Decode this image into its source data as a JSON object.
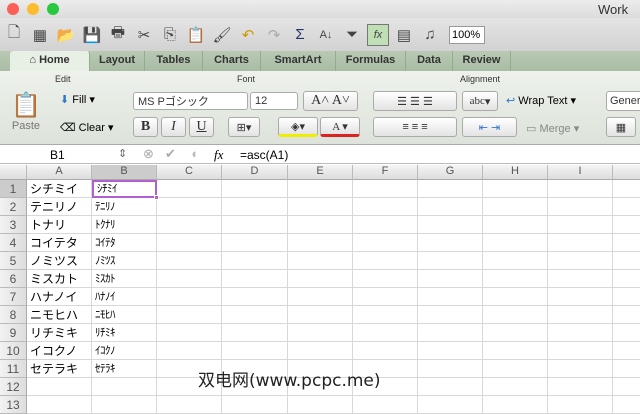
{
  "window": {
    "title": "Work"
  },
  "toolbar": {
    "zoom": "100%"
  },
  "tabs": [
    "Home",
    "Layout",
    "Tables",
    "Charts",
    "SmartArt",
    "Formulas",
    "Data",
    "Review"
  ],
  "ribbon": {
    "groups": {
      "edit": "Edit",
      "font": "Font",
      "alignment": "Alignment"
    },
    "fill": "Fill",
    "clear": "Clear",
    "paste": "Paste",
    "font_name": "MS Pゴシック",
    "font_size": "12",
    "bold": "B",
    "italic": "I",
    "underline": "U",
    "abc": "abc",
    "wrap_text": "Wrap Text",
    "merge": "Merge",
    "number_format": "Gener"
  },
  "formula_bar": {
    "name_box": "B1",
    "fx": "fx",
    "formula": "=asc(A1)"
  },
  "columns": [
    "A",
    "B",
    "C",
    "D",
    "E",
    "F",
    "G",
    "H",
    "I"
  ],
  "rows": [
    {
      "n": "1",
      "a": "シチミイ",
      "b": "ｼﾁﾐｲ"
    },
    {
      "n": "2",
      "a": "テニリノ",
      "b": "ﾃﾆﾘﾉ"
    },
    {
      "n": "3",
      "a": "トナリ",
      "b": "ﾄｸﾅﾘ"
    },
    {
      "n": "4",
      "a": "コイテタ",
      "b": "ｺｲﾃﾀ"
    },
    {
      "n": "5",
      "a": "ノミツス",
      "b": "ﾉﾐﾂｽ"
    },
    {
      "n": "6",
      "a": "ミスカト",
      "b": "ﾐｽｶﾄ"
    },
    {
      "n": "7",
      "a": "ハナノイ",
      "b": "ﾊﾅﾉｲ"
    },
    {
      "n": "8",
      "a": "ニモヒハ",
      "b": "ﾆﾓﾋﾊ"
    },
    {
      "n": "9",
      "a": "リチミキ",
      "b": "ﾘﾁﾐｷ"
    },
    {
      "n": "10",
      "a": "イコクノ",
      "b": "ｲｺｸﾉ"
    },
    {
      "n": "11",
      "a": "セテラキ",
      "b": "ｾﾃﾗｷ"
    },
    {
      "n": "12",
      "a": "",
      "b": ""
    },
    {
      "n": "13",
      "a": "",
      "b": ""
    }
  ],
  "watermark": "双电网(www.pcpc.me)"
}
